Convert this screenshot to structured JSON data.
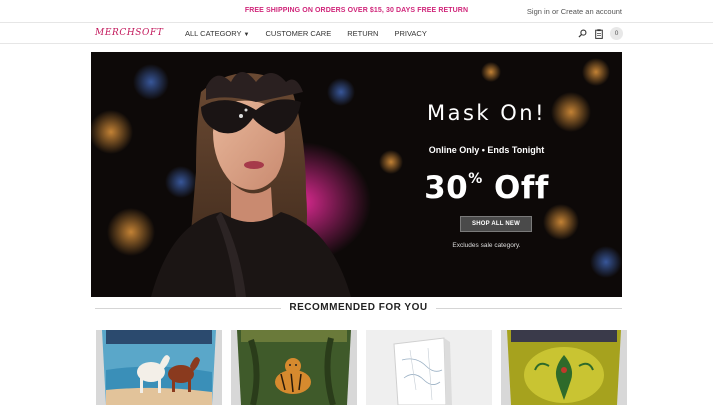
{
  "topbar": {
    "promo": "FREE SHIPPING ON ORDERS OVER $15, 30 DAYS FREE RETURN",
    "sign_in": "Sign in",
    "or": " or ",
    "create_account": "Create an account"
  },
  "nav": {
    "logo": "MERCHSOFT",
    "items": [
      {
        "label": "ALL CATEGORY",
        "dropdown": true
      },
      {
        "label": "CUSTOMER CARE"
      },
      {
        "label": "RETURN"
      },
      {
        "label": "PRIVACY"
      }
    ],
    "cart_count": "0",
    "icons": [
      "search-icon",
      "clipboard-icon",
      "cart-count-badge"
    ]
  },
  "hero": {
    "headline": "Mask On!",
    "subhead": "Online Only • Ends Tonight",
    "discount_number": "30",
    "discount_symbol": "%",
    "discount_word": " Off",
    "cta": "SHOP ALL NEW",
    "note": "Excludes sale category."
  },
  "recommended": {
    "title": "RECOMMENDED FOR YOU",
    "products": [
      {
        "name": "car-hood-horses"
      },
      {
        "name": "car-hood-tiger"
      },
      {
        "name": "canvas-map-print"
      },
      {
        "name": "car-hood-dragon"
      }
    ]
  },
  "colors": {
    "promo": "#d0267a",
    "logo": "#c2185b",
    "hero_bg": "#0d0908",
    "button": "#4a4a4a"
  }
}
